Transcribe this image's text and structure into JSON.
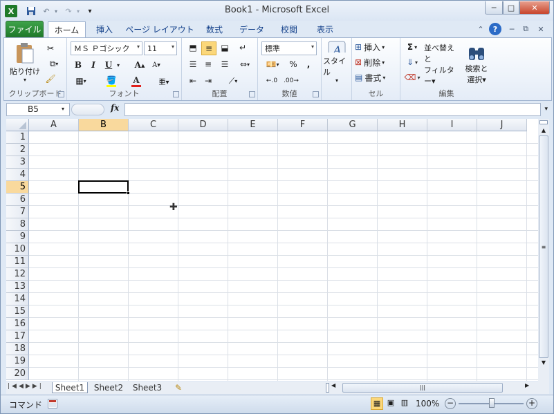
{
  "window": {
    "title": "Book1  -  Microsoft Excel",
    "controls": {
      "minimize": "─",
      "maximize": "□",
      "close": "✕"
    }
  },
  "quick_access": {
    "app_icon": "X",
    "save_icon": "save-icon",
    "undo_icon": "undo-icon",
    "redo_icon": "redo-icon",
    "customize": "▾"
  },
  "ribbon_tabs": [
    "ファイル",
    "ホーム",
    "挿入",
    "ページ レイアウト",
    "数式",
    "データ",
    "校閲",
    "表示"
  ],
  "active_tab": "ホーム",
  "clipboard": {
    "label": "クリップボード",
    "paste": "貼り付け"
  },
  "font": {
    "label": "フォント",
    "name": "ＭＳ Ｐゴシック",
    "size": "11",
    "bold": "B",
    "italic": "I",
    "underline": "U",
    "grow": "A",
    "shrink": "A",
    "color_letter": "A"
  },
  "alignment": {
    "label": "配置"
  },
  "number": {
    "label": "数値",
    "format": "標準",
    "percent": "%",
    "comma": ","
  },
  "styles": {
    "label": "スタイル"
  },
  "cells": {
    "label": "セル",
    "insert": "挿入",
    "delete": "削除",
    "format": "書式"
  },
  "editing": {
    "label": "編集",
    "sort_filter_1": "並べ替えと",
    "sort_filter_2": "フィルター",
    "find_select_1": "検索と",
    "find_select_2": "選択",
    "sigma": "Σ"
  },
  "formula_bar": {
    "name_box": "B5",
    "fx": "fx",
    "content": ""
  },
  "columns": [
    "A",
    "B",
    "C",
    "D",
    "E",
    "F",
    "G",
    "H",
    "I",
    "J"
  ],
  "rows": [
    "1",
    "2",
    "3",
    "4",
    "5",
    "6",
    "7",
    "8",
    "9",
    "10",
    "11",
    "12",
    "13",
    "14",
    "15",
    "16",
    "17",
    "18",
    "19",
    "20"
  ],
  "active_cell": {
    "col": "B",
    "row": "5"
  },
  "sheets": [
    "Sheet1",
    "Sheet2",
    "Sheet3"
  ],
  "active_sheet": "Sheet1",
  "status": {
    "mode": "コマンド",
    "zoom": "100%"
  },
  "colors": {
    "accent": "#1f7a2a",
    "selected_header": "#f9d99d",
    "ribbon_text": "#15428b"
  }
}
